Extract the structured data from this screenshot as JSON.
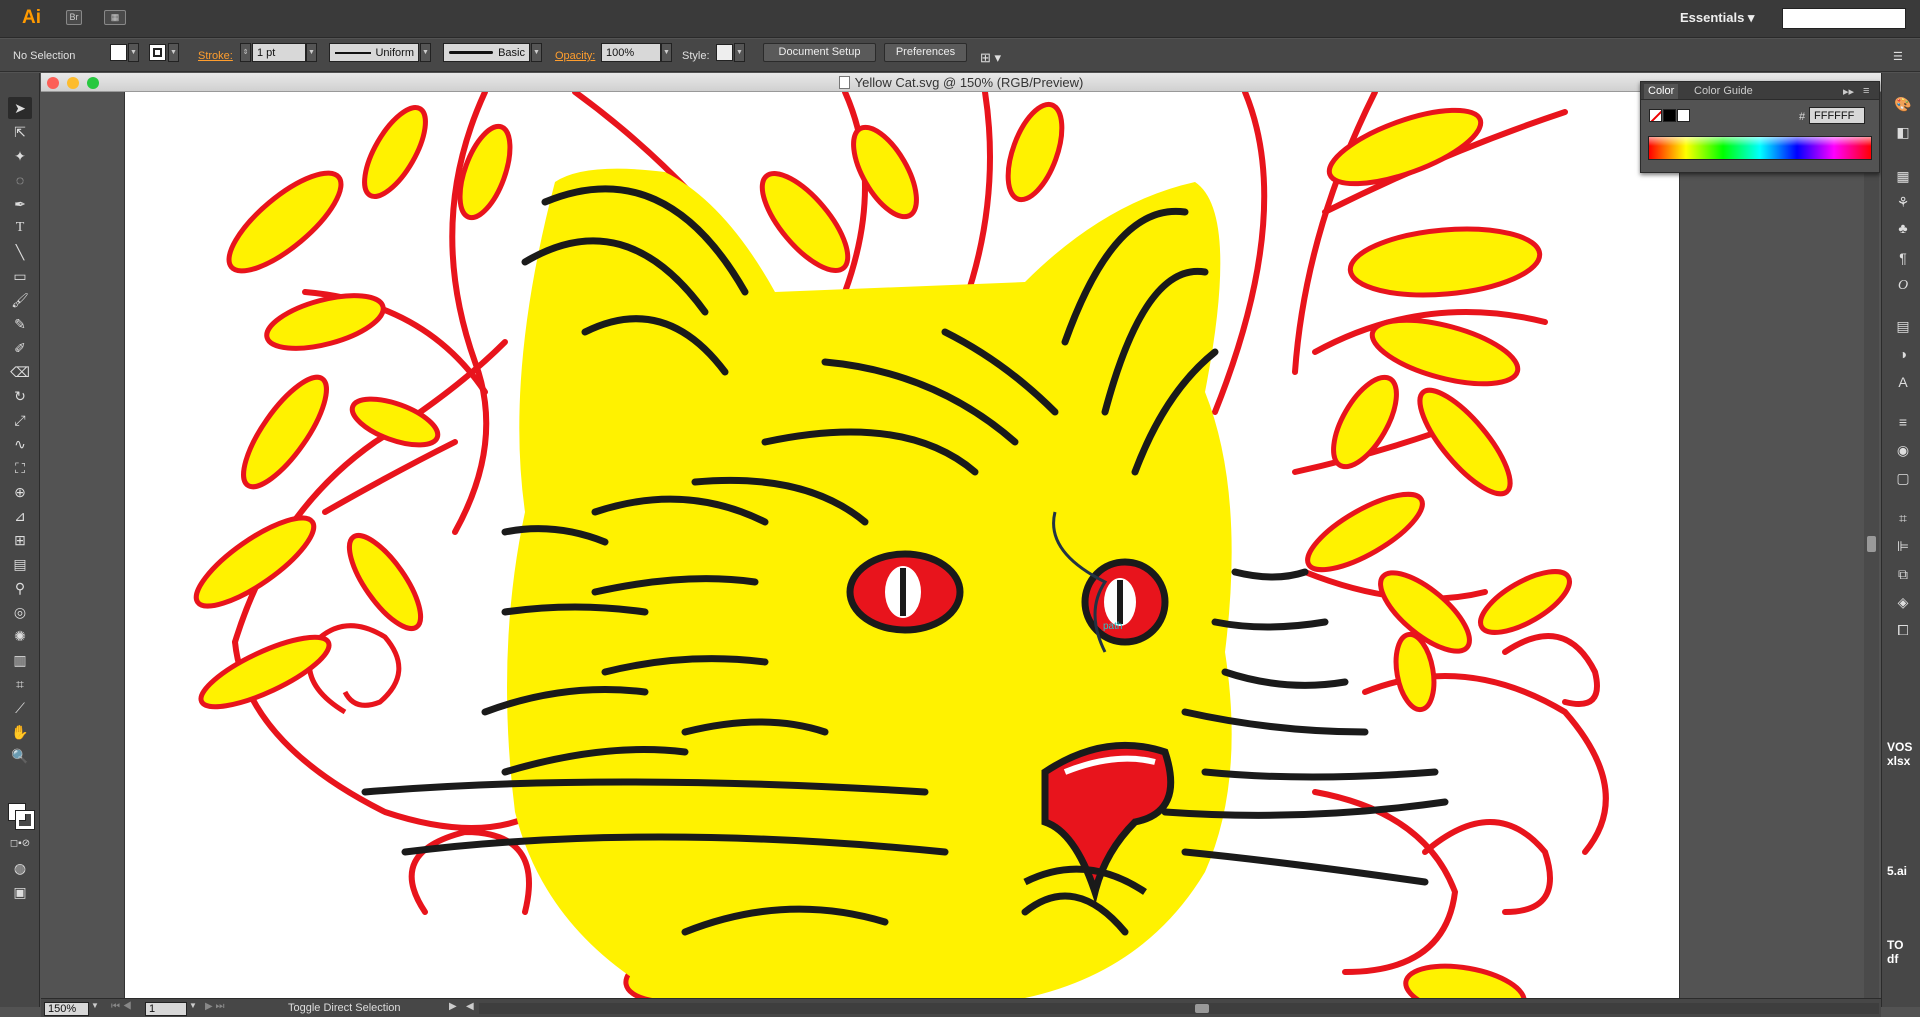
{
  "app": {
    "logo": "Ai",
    "bridge_label": "Br",
    "workspace": "Essentials ▾"
  },
  "control_bar": {
    "selection": "No Selection",
    "stroke_label": "Stroke:",
    "stroke_weight": "1 pt",
    "stroke_profile": "Uniform",
    "brush": "Basic",
    "opacity_label": "Opacity:",
    "opacity_value": "100%",
    "style_label": "Style:",
    "document_setup": "Document Setup",
    "preferences": "Preferences"
  },
  "document": {
    "title": "Yellow Cat.svg @ 150% (RGB/Preview)",
    "path_hint": "path"
  },
  "color_panel": {
    "tab_color": "Color",
    "tab_guide": "Color Guide",
    "hash": "#",
    "hex_value": "FFFFFF"
  },
  "status": {
    "zoom": "150%",
    "artboard": "1",
    "tool_hint": "Toggle Direct Selection"
  },
  "desktop": {
    "file1_line1": "VOS",
    "file1_line2": "xlsx",
    "file2": "5.ai",
    "file3_line1": "TO",
    "file3_line2": "df"
  },
  "colors": {
    "cat_yellow": "#fff200",
    "leaf_red": "#e8141c",
    "stripe_black": "#1a1a1a",
    "accent_orange": "#ff9e2e"
  }
}
